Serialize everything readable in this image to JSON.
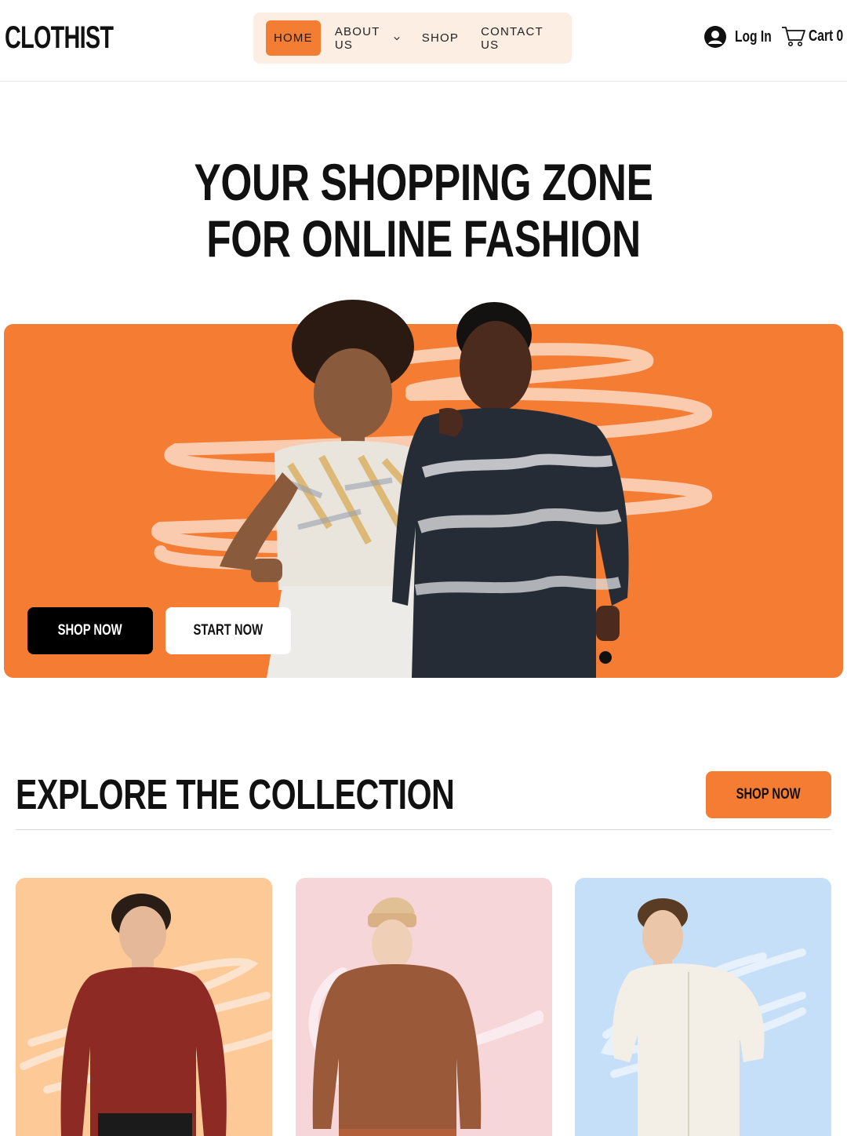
{
  "header": {
    "logo": "CLOTHIST",
    "nav": [
      {
        "label": "HOME",
        "active": true
      },
      {
        "label": "ABOUT US",
        "dropdown": true
      },
      {
        "label": "SHOP"
      },
      {
        "label": "CONTACT US"
      }
    ],
    "login_label": "Log In",
    "cart_label": "Cart",
    "cart_count": "0"
  },
  "hero": {
    "title_line1": "YOUR SHOPPING ZONE",
    "title_line2": "FOR ONLINE FASHION",
    "shop_now_label": "SHOP NOW",
    "start_now_label": "START NOW"
  },
  "collection": {
    "title": "EXPLORE THE COLLECTION",
    "shop_now_label": "SHOP NOW",
    "cards": [
      {
        "bg": "#fdc997",
        "garment": "maroon sweatshirt"
      },
      {
        "bg": "#f6d6d9",
        "garment": "brown sweatshirt"
      },
      {
        "bg": "#c6dff9",
        "garment": "cream shirt"
      }
    ]
  },
  "colors": {
    "accent": "#f57d33",
    "nav_bg": "#fdeee4",
    "text": "#111111"
  }
}
